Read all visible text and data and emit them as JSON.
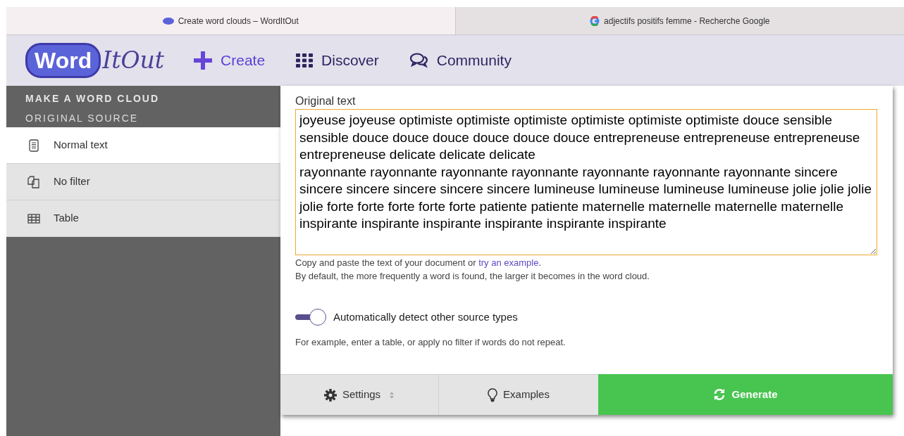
{
  "browser_tabs": [
    {
      "title": "Create word clouds – WordItOut",
      "kind": "wordit",
      "selected": true
    },
    {
      "title": "adjectifs positifs femme - Recherche Google",
      "kind": "google",
      "selected": false
    }
  ],
  "header": {
    "logo_box": "Word",
    "logo_rest": "ItOut",
    "nav": [
      {
        "label": "Create",
        "kind": "plus",
        "selected": true
      },
      {
        "label": "Discover",
        "kind": "grid",
        "selected": false
      },
      {
        "label": "Community",
        "kind": "chat",
        "selected": false
      }
    ]
  },
  "sidebar": {
    "title": "MAKE A WORD CLOUD",
    "subtitle": "ORIGINAL SOURCE",
    "items": [
      {
        "label": "Normal text",
        "kind": "doc",
        "selected": true
      },
      {
        "label": "No filter",
        "kind": "copy",
        "selected": false
      },
      {
        "label": "Table",
        "kind": "table",
        "selected": false
      }
    ]
  },
  "main": {
    "label": "Original text",
    "value": "joyeuse joyeuse optimiste optimiste optimiste optimiste optimiste optimiste douce sensible sensible douce douce douce douce douce douce entrepreneuse entrepreneuse entrepreneuse entrepreneuse delicate delicate delicate\nrayonnante rayonnante rayonnante rayonnante rayonnante rayonnante rayonnante sincere sincere sincere sincere sincere sincere lumineuse lumineuse lumineuse lumineuse jolie jolie jolie jolie forte forte forte forte forte patiente patiente maternelle maternelle maternelle maternelle inspirante inspirante inspirante inspirante inspirante inspirante",
    "help_before": "Copy and paste the text of your document or ",
    "help_link": "try an example",
    "help_after": ".",
    "help_2": "By default, the more frequently a word is found, the larger it becomes in the word cloud.",
    "toggle": {
      "label": "Automatically detect other source types",
      "on": true
    },
    "hint": "For example, enter a table, or apply no filter if words do not repeat.",
    "buttons": [
      {
        "label": "Settings",
        "kind": "settings"
      },
      {
        "label": "Examples",
        "kind": "examples"
      },
      {
        "label": "Generate",
        "kind": "generate"
      }
    ]
  }
}
